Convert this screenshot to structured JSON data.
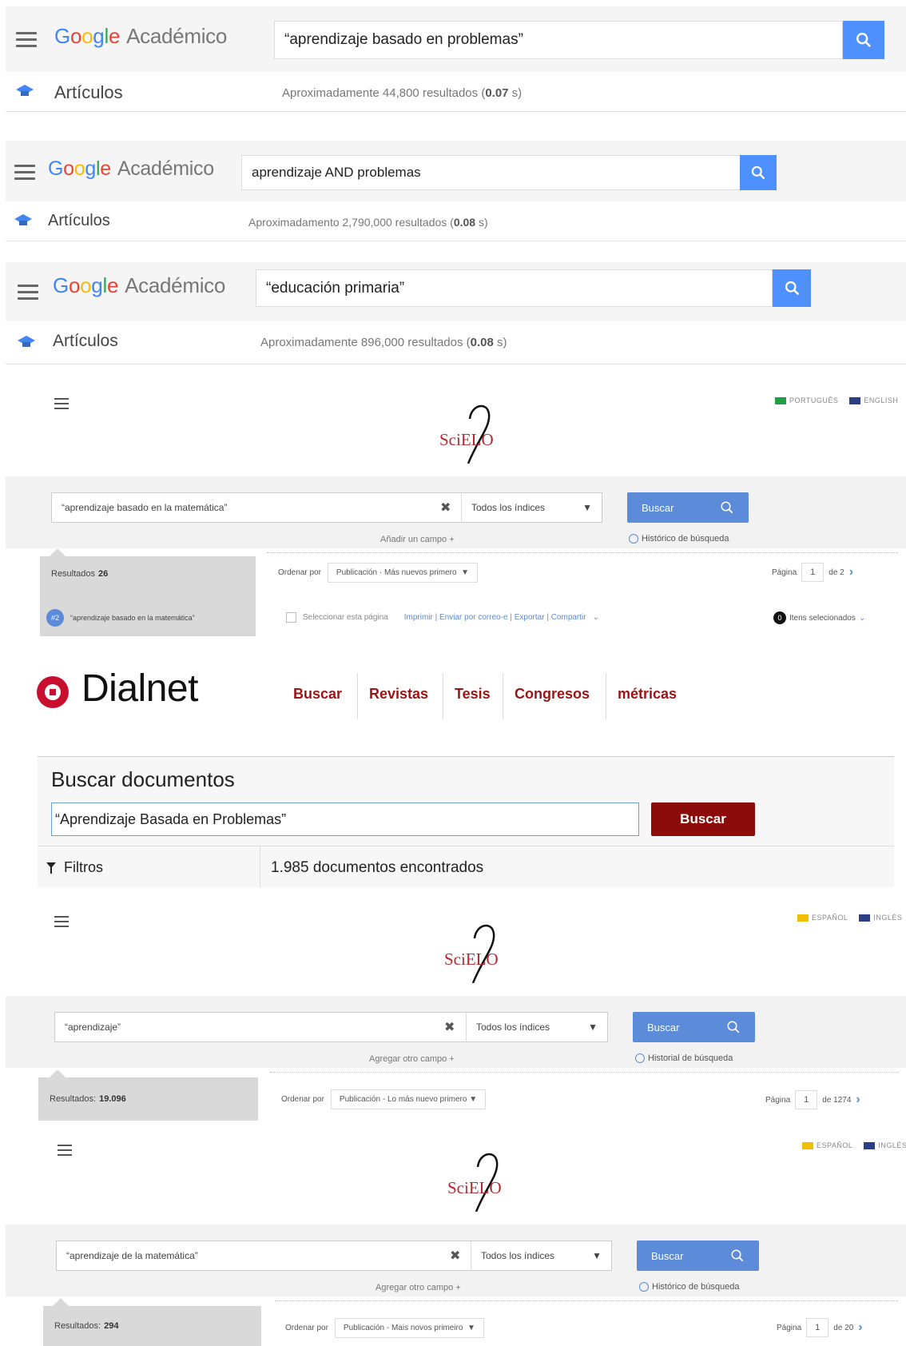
{
  "gs": [
    {
      "logo_google": "Google",
      "logo_suffix": "Académico",
      "query": "“aprendizaje basado en problemas”",
      "section": "Artículos",
      "results_prefix": "Aproximadamente 44,800 resultados (",
      "results_time": "0.07",
      "results_suffix": " s)"
    },
    {
      "logo_google": "Google",
      "logo_suffix": "Académico",
      "query": "aprendizaje AND problemas",
      "section": "Artículos",
      "results_prefix": "Aproximadamento 2,790,000 resultados (",
      "results_time": "0.08",
      "results_suffix": " s)"
    },
    {
      "logo_google": "Google",
      "logo_suffix": "Académico",
      "query": "“educación primaria”",
      "section": "Artículos",
      "results_prefix": "Aproximadamente 896,000 resultados (",
      "results_time": "0.08",
      "results_suffix": " s)"
    }
  ],
  "scielo": [
    {
      "lang1": "PORTUGUÊS",
      "lang2": "ENGLISH",
      "logo": "SciELO",
      "query": "“aprendizaje basado en la matemática”",
      "index": "Todos los índices",
      "search": "Buscar",
      "add_field": "Añadir un campo +",
      "history": "Histórico de búsqueda",
      "results_label": "Resultados",
      "results_count": "26",
      "order_label": "Ordenar por",
      "order_value": "Publicación · Más nuevos primero",
      "page_label": "Página",
      "page_num": "1",
      "page_total": "de 2",
      "history_item_badge": "#2",
      "history_item": "“aprendizaje basado en la matemática”",
      "select_page": "Seleccionar esta página",
      "actions": "Imprimir | Enviar por correo-e | Exportar | Compartir",
      "selected_count": "0",
      "selected_label": "Itens selecionados"
    },
    {
      "lang1": "ESPAÑOL",
      "lang2": "INGLÉS",
      "logo": "SciELO",
      "query": "“aprendizaje”",
      "index": "Todos los índices",
      "search": "Buscar",
      "add_field": "Agregar otro campo +",
      "history": "Historial de búsqueda",
      "results_label": "Resultados:",
      "results_count": "19.096",
      "order_label": "Ordenar por",
      "order_value": "Publicación - Lo más nuevo primero",
      "page_label": "Página",
      "page_num": "1",
      "page_total": "de 1274"
    },
    {
      "lang1": "ESPAÑOL",
      "lang2": "INGLÉS",
      "logo": "SciELO",
      "query": "“aprendizaje de la matemática”",
      "index": "Todos los índices",
      "search": "Buscar",
      "add_field": "Agregar otro campo +",
      "history": "Histórico de búsqueda",
      "results_label": "Resultados:",
      "results_count": "294",
      "order_label": "Ordenar por",
      "order_value": "Publicación - Mais novos primeiro",
      "page_label": "Página",
      "page_num": "1",
      "page_total": "de 20"
    }
  ],
  "dialnet": {
    "logo": "Dialnet",
    "nav": [
      "Buscar",
      "Revistas",
      "Tesis",
      "Congresos",
      "métricas"
    ],
    "heading": "Buscar documentos",
    "query": "“Aprendizaje Basada en Problemas”",
    "search": "Buscar",
    "filters": "Filtros",
    "results": "1.985 documentos encontrados"
  },
  "colors": {
    "google_blue": "#4d90fe",
    "scielo_blue": "#5b8bd9",
    "scielo_red": "#b5292e",
    "dialnet_red": "#9b1515"
  }
}
